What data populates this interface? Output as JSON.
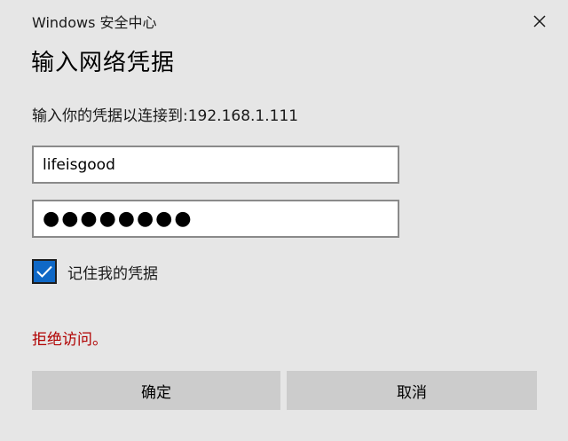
{
  "window": {
    "title": "Windows 安全中心"
  },
  "dialog": {
    "heading": "输入网络凭据",
    "description": "输入你的凭据以连接到:192.168.1.111",
    "username_value": "lifeisgood",
    "password_mask": "●●●●●●●●",
    "remember": {
      "label": "记住我的凭据",
      "checked": true
    },
    "error_message": "拒绝访问。",
    "ok_label": "确定",
    "cancel_label": "取消"
  },
  "icons": {
    "close": "close-icon",
    "check": "checkmark-icon"
  },
  "colors": {
    "background": "#e6e6e6",
    "accent": "#0f68c6",
    "error": "#b00000",
    "button": "#cccccc"
  }
}
